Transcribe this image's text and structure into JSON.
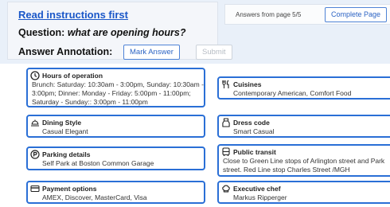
{
  "instructions": {
    "link_text": "Read instructions first"
  },
  "question": {
    "prefix": "Question:",
    "text": "what are opening hours?"
  },
  "annotation": {
    "label": "Answer Annotation:",
    "mark_button": "Mark Answer",
    "submit_button": "Submit"
  },
  "answers": {
    "status": "Answers from page 5/5",
    "complete_button": "Complete Page"
  },
  "cards": {
    "hours": {
      "title": "Hours of operation",
      "lines": [
        "Brunch: Saturday: 10:30am - 3:00pm, Sunday: 10:30am -",
        "3:00pm; Dinner: Monday - Friday: 5:00pm - 11:00pm;",
        "Saturday - Sunday:: 3:00pm - 11:00pm"
      ]
    },
    "cuisines": {
      "title": "Cuisines",
      "value": "Contemporary American, Comfort Food"
    },
    "dining_style": {
      "title": "Dining Style",
      "value": "Casual Elegant"
    },
    "dress_code": {
      "title": "Dress code",
      "value": "Smart Casual"
    },
    "parking": {
      "title": "Parking details",
      "value": "Self Park at Boston Common Garage"
    },
    "transit": {
      "title": "Public transit",
      "lines": [
        "Close to Green Line stops of Arlington street and Park",
        "street. Red Line stop Charles Street /MGH"
      ]
    },
    "payment": {
      "title": "Payment options",
      "value": "AMEX, Discover, MasterCard, Visa"
    },
    "chef": {
      "title": "Executive chef",
      "value": "Markus Ripperger"
    }
  },
  "colors": {
    "accent": "#2a6fd6",
    "link": "#1a57c8",
    "topbar": "#e9f0f9"
  }
}
